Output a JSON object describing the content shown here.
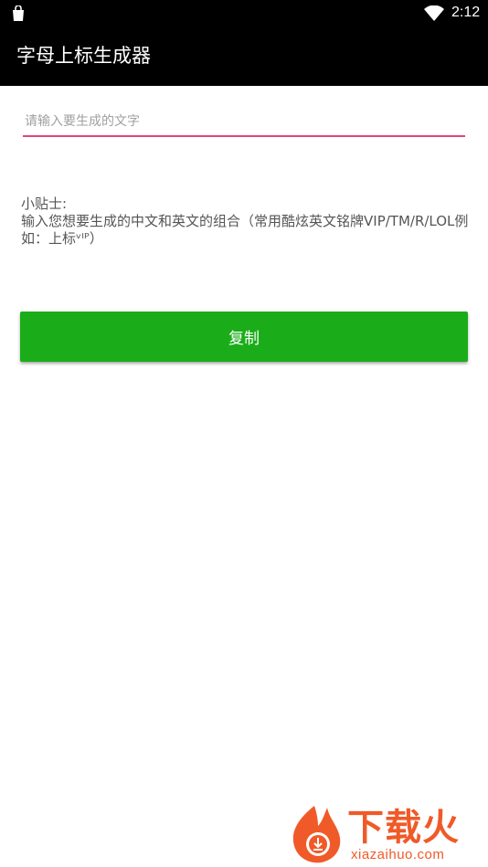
{
  "status_bar": {
    "time": "2:12",
    "icons": [
      "shopping-bag-icon",
      "wifi-icon"
    ]
  },
  "app_bar": {
    "title": "字母上标生成器"
  },
  "input": {
    "placeholder": "请输入要生成的文字",
    "value": ""
  },
  "tips": {
    "label": "小贴士:",
    "body": "输入您想要生成的中文和英文的组合（常用酷炫英文铭牌VIP/TM/R/LOL例如：上标ᵛᴵᴾ）"
  },
  "copy_button": {
    "label": "复制"
  },
  "watermark": {
    "text": "下载火",
    "url": "xiazaihuo.com"
  },
  "colors": {
    "app_bar_bg": "#000000",
    "input_underline": "#e0457b",
    "button_bg": "#1aad19",
    "watermark": "#f05a28"
  }
}
